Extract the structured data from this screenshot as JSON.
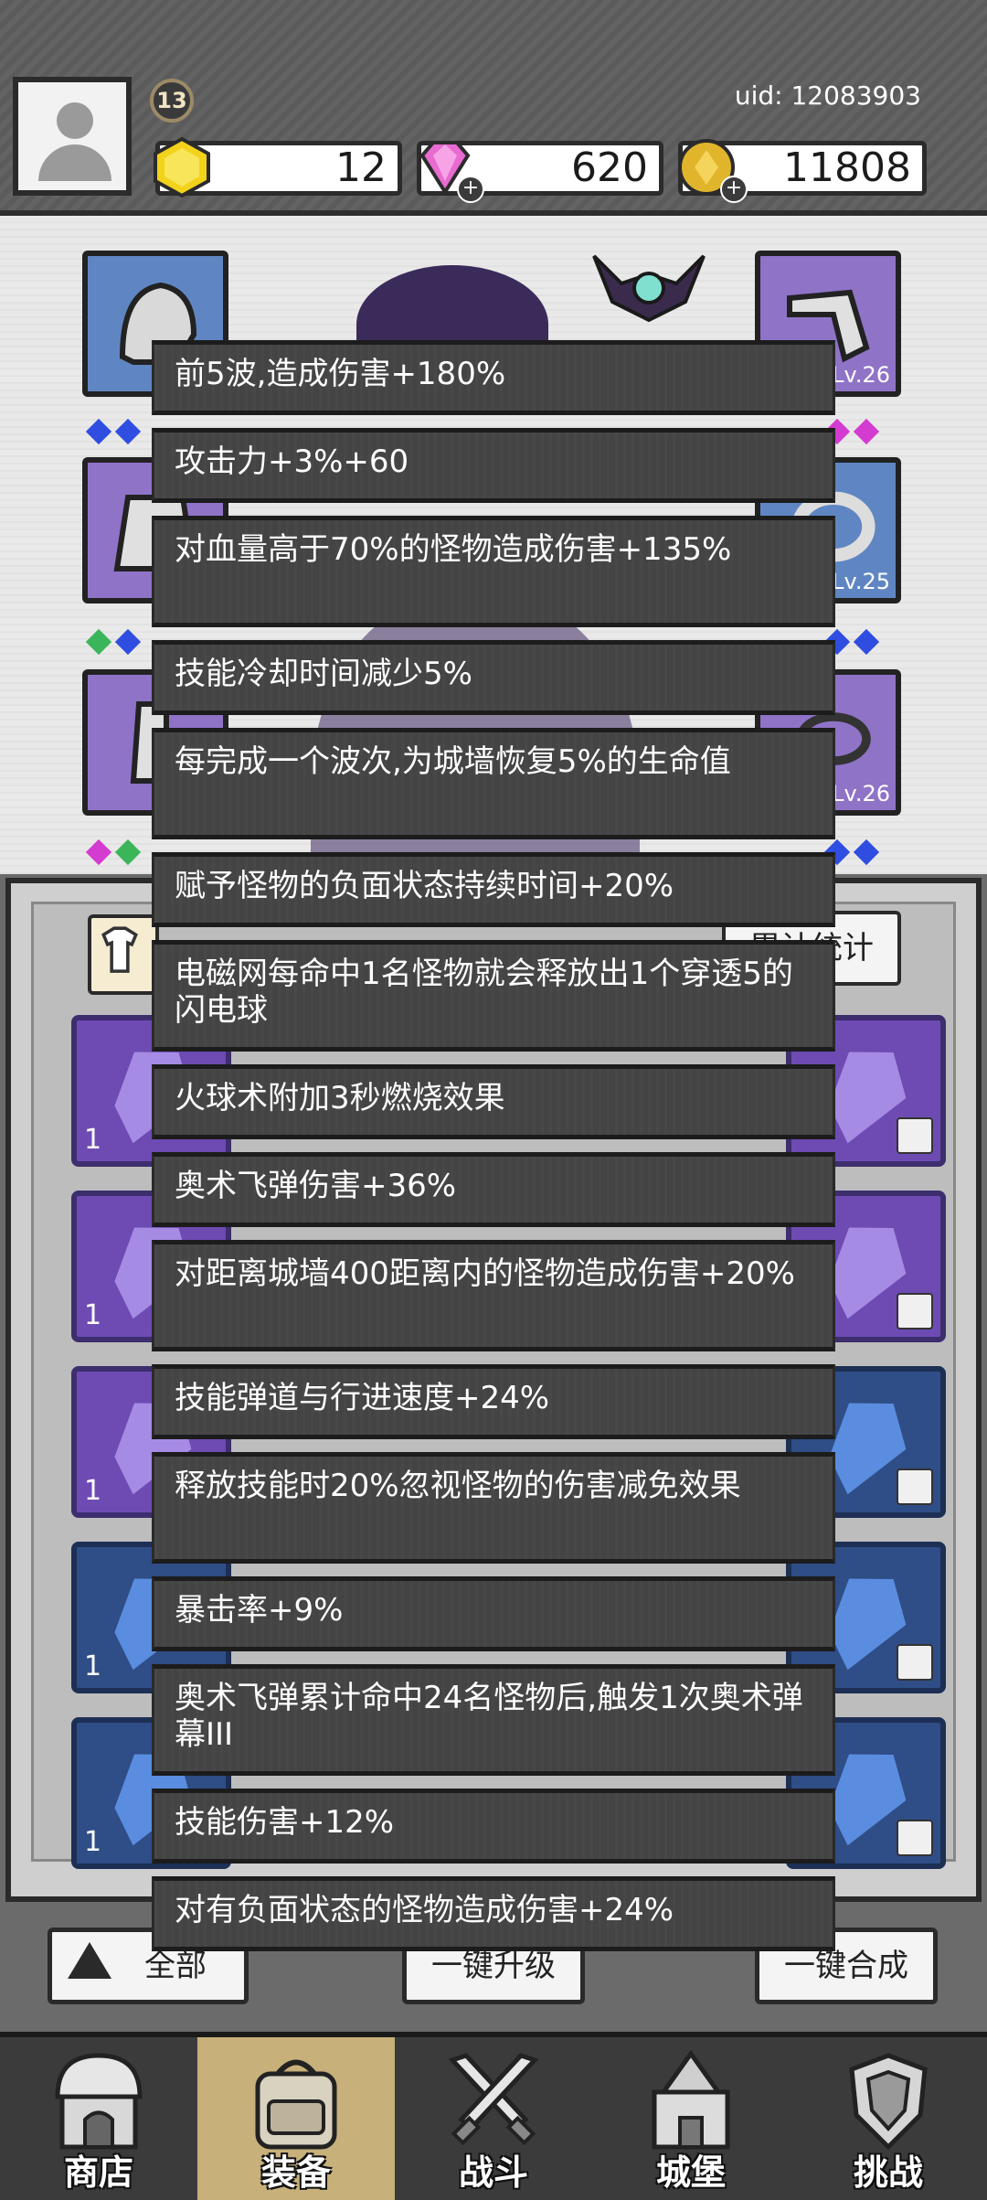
{
  "header": {
    "level": "13",
    "uid": "uid: 12083903",
    "currencies": [
      {
        "name": "gold-hexagon",
        "value": "12",
        "color": "#f2d21b"
      },
      {
        "name": "gem",
        "value": "620",
        "color": "#e86bd1"
      },
      {
        "name": "coin",
        "value": "11808",
        "color": "#e0b52b"
      }
    ]
  },
  "equipment": {
    "slots": [
      {
        "side": "left",
        "lv": ""
      },
      {
        "side": "left",
        "lv": ""
      },
      {
        "side": "left",
        "lv": ""
      },
      {
        "side": "right",
        "lv": "Lv.26"
      },
      {
        "side": "right",
        "lv": "Lv.25"
      },
      {
        "side": "right",
        "lv": "Lv.26"
      }
    ]
  },
  "inventory": {
    "stats_button_label": "累计统计",
    "counts": [
      "1",
      "1",
      "1",
      "1",
      "1"
    ]
  },
  "actions": {
    "all_label": "全部",
    "upgrade_label": "一键升级",
    "merge_label": "一键合成"
  },
  "tooltips": [
    "前5波,造成伤害+180%",
    "攻击力+3%+60",
    "对血量高于70%的怪物造成伤害+135%",
    "技能冷却时间减少5%",
    "每完成一个波次,为城墙恢复5%的生命值",
    "赋予怪物的负面状态持续时间+20%",
    "电磁网每命中1名怪物就会释放出1个穿透5的闪电球",
    "火球术附加3秒燃烧效果",
    "奥术飞弹伤害+36%",
    "对距离城墙400距离内的怪物造成伤害+20%",
    "技能弹道与行进速度+24%",
    "释放技能时20%忽视怪物的伤害减免效果",
    "暴击率+9%",
    "奥术飞弹累计命中24名怪物后,触发1次奥术弹幕III",
    "技能伤害+12%",
    "对有负面状态的怪物造成伤害+24%"
  ],
  "nav": [
    {
      "label": "商店",
      "icon": "shop-icon"
    },
    {
      "label": "装备",
      "icon": "backpack-icon",
      "active": true
    },
    {
      "label": "战斗",
      "icon": "crossed-swords-icon"
    },
    {
      "label": "城堡",
      "icon": "castle-icon"
    },
    {
      "label": "挑战",
      "icon": "shield-icon"
    }
  ]
}
